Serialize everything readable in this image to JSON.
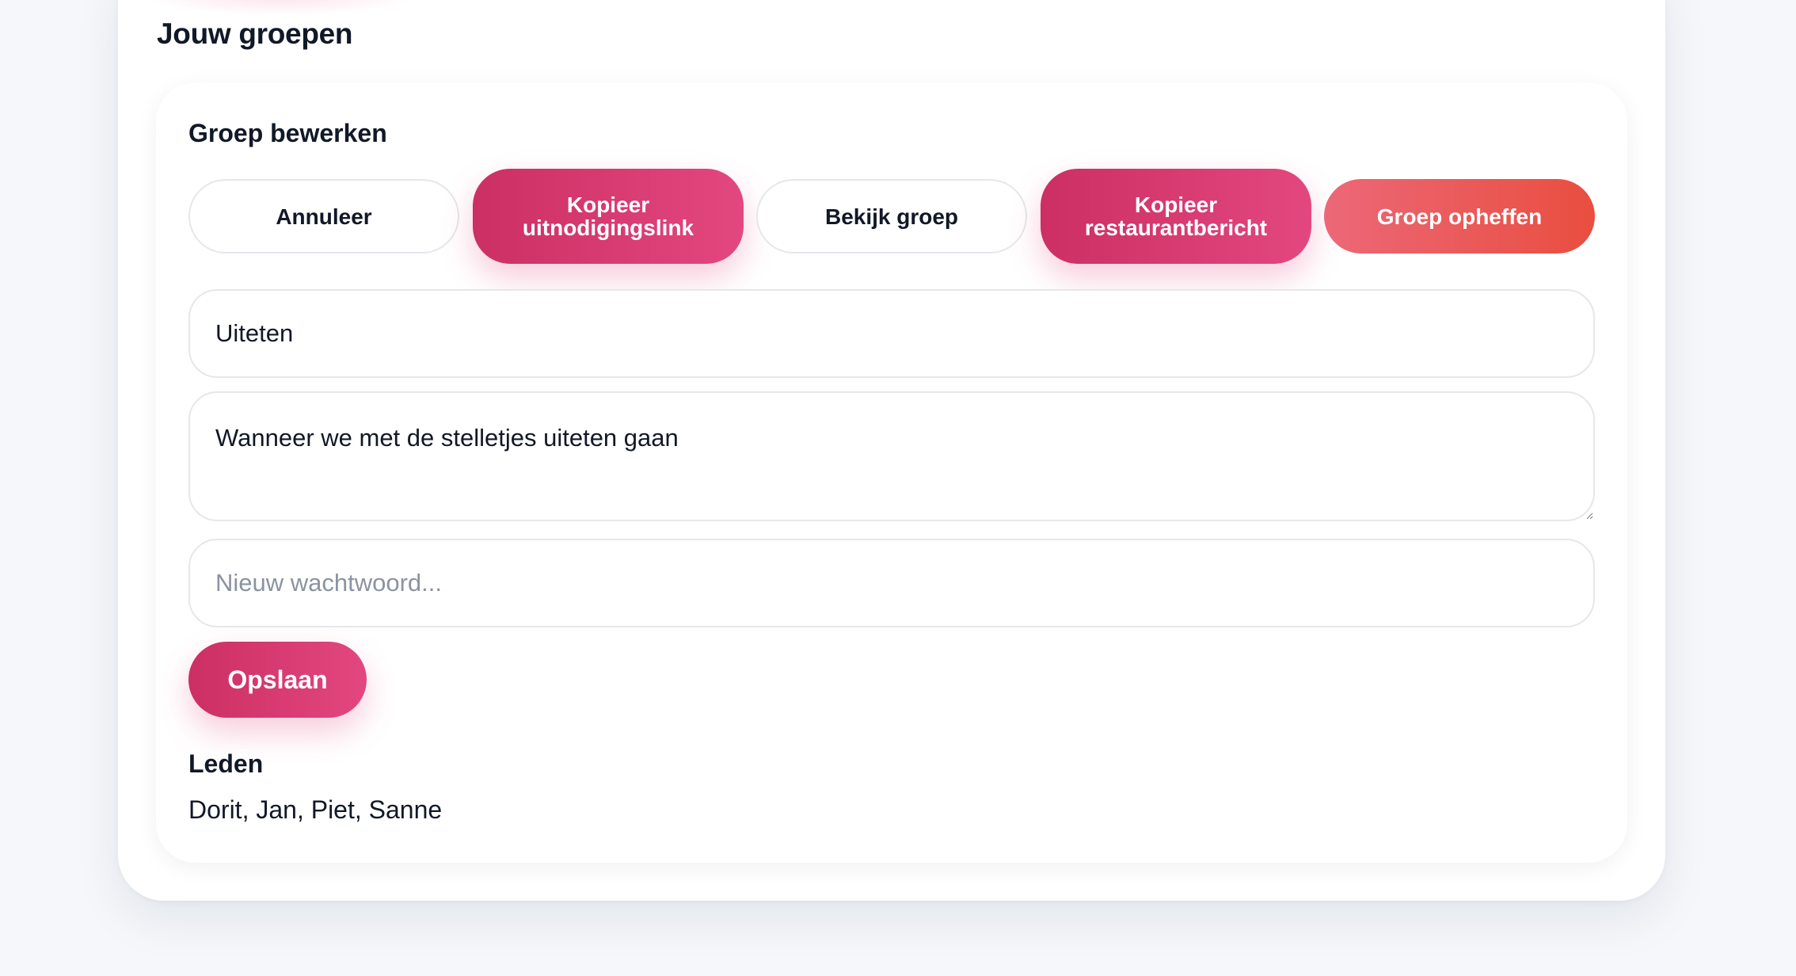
{
  "section": {
    "title": "Jouw groepen"
  },
  "edit_group": {
    "title": "Groep bewerken",
    "buttons": {
      "cancel": "Annuleer",
      "copy_invite": "Kopieer uitnodigingslink",
      "view_group": "Bekijk groep",
      "copy_restaurant": "Kopieer restaurantbericht",
      "delete_group": "Groep opheffen"
    },
    "name_value": "Uiteten",
    "description_value": "Wanneer we met de stelletjes uiteten gaan",
    "password_placeholder": "Nieuw wachtwoord...",
    "save_label": "Opslaan",
    "members_title": "Leden",
    "members_list": "Dorit, Jan, Piet, Sanne"
  },
  "colors": {
    "accent_pink": "#e2477e",
    "accent_pink_dark": "#cc2f63",
    "danger_red": "#e94e3f",
    "text": "#111827",
    "background": "#f5f7fb"
  }
}
